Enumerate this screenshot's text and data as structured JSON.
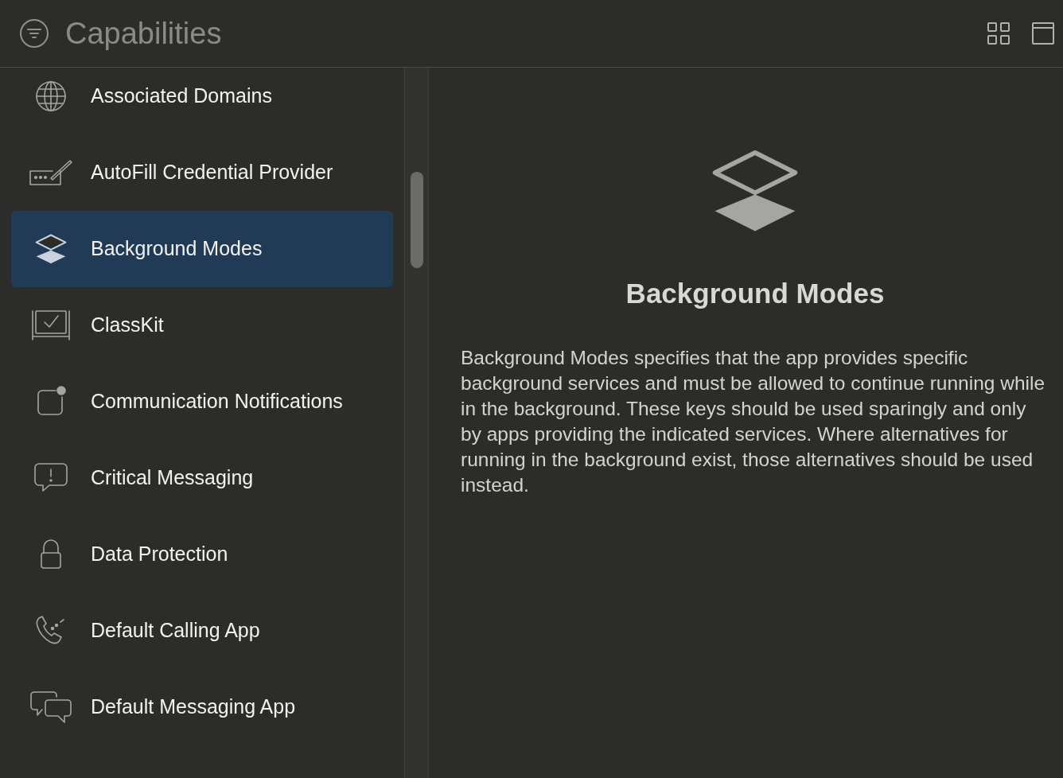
{
  "header": {
    "title": "Capabilities"
  },
  "sidebar": {
    "items": [
      {
        "label": "Associated Domains",
        "selected": false
      },
      {
        "label": "AutoFill Credential Provider",
        "selected": false
      },
      {
        "label": "Background Modes",
        "selected": true
      },
      {
        "label": "ClassKit",
        "selected": false
      },
      {
        "label": "Communication Notifications",
        "selected": false
      },
      {
        "label": "Critical Messaging",
        "selected": false
      },
      {
        "label": "Data Protection",
        "selected": false
      },
      {
        "label": "Default Calling App",
        "selected": false
      },
      {
        "label": "Default Messaging App",
        "selected": false
      }
    ]
  },
  "detail": {
    "title": "Background Modes",
    "description": "Background Modes specifies that the app provides specific background services and must be allowed to continue running while in the background. These keys should be used sparingly and only by apps providing the indicated services. Where alternatives for running in the background exist, those alternatives should be used instead."
  }
}
